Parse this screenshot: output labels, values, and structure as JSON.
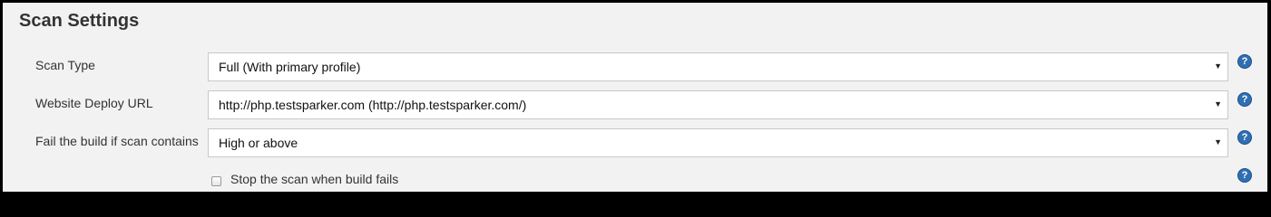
{
  "section": {
    "title": "Scan Settings"
  },
  "fields": [
    {
      "label": "Scan Type",
      "value": "Full (With primary profile)",
      "arrow": "▼"
    },
    {
      "label": "Website Deploy URL",
      "value": "http://php.testsparker.com (http://php.testsparker.com/)",
      "arrow": "▼"
    },
    {
      "label": "Fail the build if scan contains",
      "value": "High or above",
      "arrow": "▼"
    }
  ],
  "stop_on_fail": {
    "label": "Stop the scan when build fails",
    "checked": false
  },
  "help": {
    "glyph": "?",
    "icon": "help-icon",
    "color": "#2f6fb3"
  }
}
